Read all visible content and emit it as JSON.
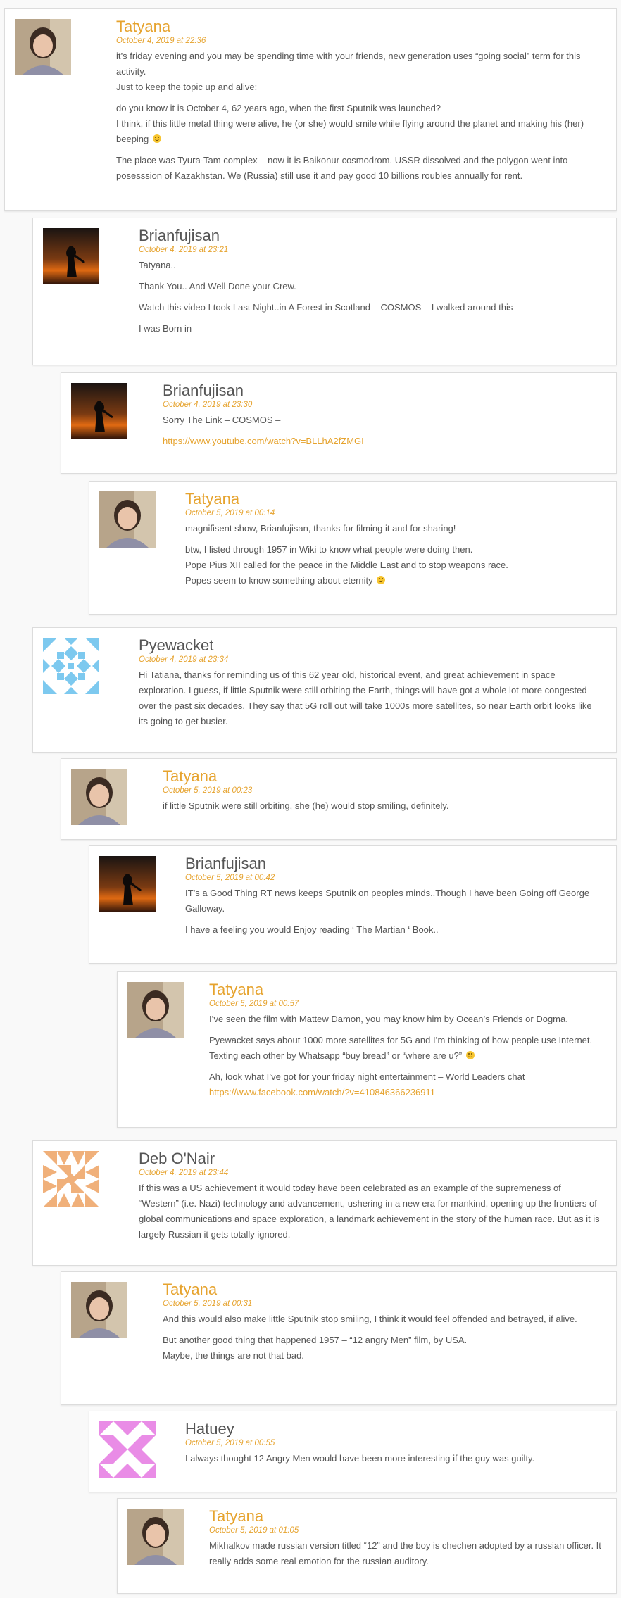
{
  "comments": [
    {
      "author": "Tatyana",
      "date": "October 4, 2019 at 22:36",
      "paragraphs": [
        "it’s friday evening and you may be spending time with your friends, new generation uses “going social” term for this activity.\nJust to keep the topic up and alive:",
        "do you know it is October 4, 62 years ago, when the first Sputnik was launched?\nI think, if this little metal thing were alive, he (or she) would smile while flying around the planet and making his (her) beeping",
        "The place was Tyura-Tam complex – now it is Baikonur cosmodrom. USSR dissolved and the polygon went into posesssion of Kazakhstan. We (Russia) still use it and pay good 10 billions roubles annually for rent."
      ]
    },
    {
      "author": "Brianfujisan",
      "date": "October 4, 2019 at 23:21",
      "paragraphs": [
        "Tatyana..",
        "Thank You.. And Well Done your Crew.",
        "Watch this video I took Last Night..in A Forest in Scotland – COSMOS – I walked around this –",
        "I was Born in"
      ]
    },
    {
      "author": "Brianfujisan",
      "date": "October 4, 2019 at 23:30",
      "paragraphs": [
        "Sorry The Link – COSMOS –"
      ],
      "link": "https://www.youtube.com/watch?v=BLLhA2fZMGI"
    },
    {
      "author": "Tatyana",
      "date": "October 5, 2019 at 00:14",
      "paragraphs": [
        "magnifisent show, Brianfujisan, thanks for filming it and for sharing!",
        "btw, I listed through 1957 in Wiki to know what people were doing then.\nPope Pius XII called for the peace in the Middle East and to stop weapons race.\nPopes seem to know something about eternity"
      ]
    },
    {
      "author": "Pyewacket",
      "date": "October 4, 2019 at 23:34",
      "paragraphs": [
        "Hi Tatiana, thanks for reminding us of this 62 year old, historical event, and great achievement in space exploration. I guess, if little Sputnik were still orbiting the Earth, things will have got a whole lot more congested over the past six decades. They say that 5G roll out will take 1000s more satellites, so near Earth orbit looks like its going to get busier."
      ]
    },
    {
      "author": "Tatyana",
      "date": "October 5, 2019 at 00:23",
      "paragraphs": [
        "if little Sputnik were still orbiting, she (he) would stop smiling, definitely."
      ]
    },
    {
      "author": "Brianfujisan",
      "date": "October 5, 2019 at 00:42",
      "paragraphs": [
        "IT’s a Good Thing RT news keeps Sputnik on peoples minds..Though I have been Going off George Galloway.",
        "I have a feeling you would Enjoy reading ‘ The Martian ‘ Book.."
      ]
    },
    {
      "author": "Tatyana",
      "date": "October 5, 2019 at 00:57",
      "paragraphs": [
        "I’ve seen the film with Mattew Damon, you may know him by Ocean’s Friends or Dogma.",
        "Pyewacket says about 1000 more satellites for 5G and I’m thinking of how people use Internet. Texting each other by Whatsapp “buy bread” or “where are u?”",
        "Ah, look what I’ve got for your friday night entertainment – World Leaders chat"
      ],
      "link": "https://www.facebook.com/watch/?v=410846366236911"
    },
    {
      "author": "Deb O'Nair",
      "date": "October 4, 2019 at 23:44",
      "paragraphs": [
        "If this was a US achievement it would today have been celebrated as an example of the supremeness of “Western” (i.e. Nazi) technology and advancement, ushering in a new era for mankind, opening up the frontiers of global communications and space exploration, a landmark achievement in the story of the human race. But as it is largely Russian it gets totally ignored."
      ]
    },
    {
      "author": "Tatyana",
      "date": "October 5, 2019 at 00:31",
      "paragraphs": [
        "And this would also make little Sputnik stop smiling, I think it would feel offended and betrayed, if alive.",
        "But another good thing that happened 1957 – “12 angry Men” film, by USA.\nMaybe, the things are not that bad."
      ]
    },
    {
      "author": "Hatuey",
      "date": "October 5, 2019 at 00:55",
      "paragraphs": [
        "I always thought 12 Angry Men would have been more interesting if the guy was guilty."
      ]
    },
    {
      "author": "Tatyana",
      "date": "October 5, 2019 at 01:05",
      "paragraphs": [
        "Mikhalkov made russian version titled “12” and the boy is chechen adopted by a russian officer. It really adds some real emotion for the russian auditory."
      ]
    }
  ]
}
